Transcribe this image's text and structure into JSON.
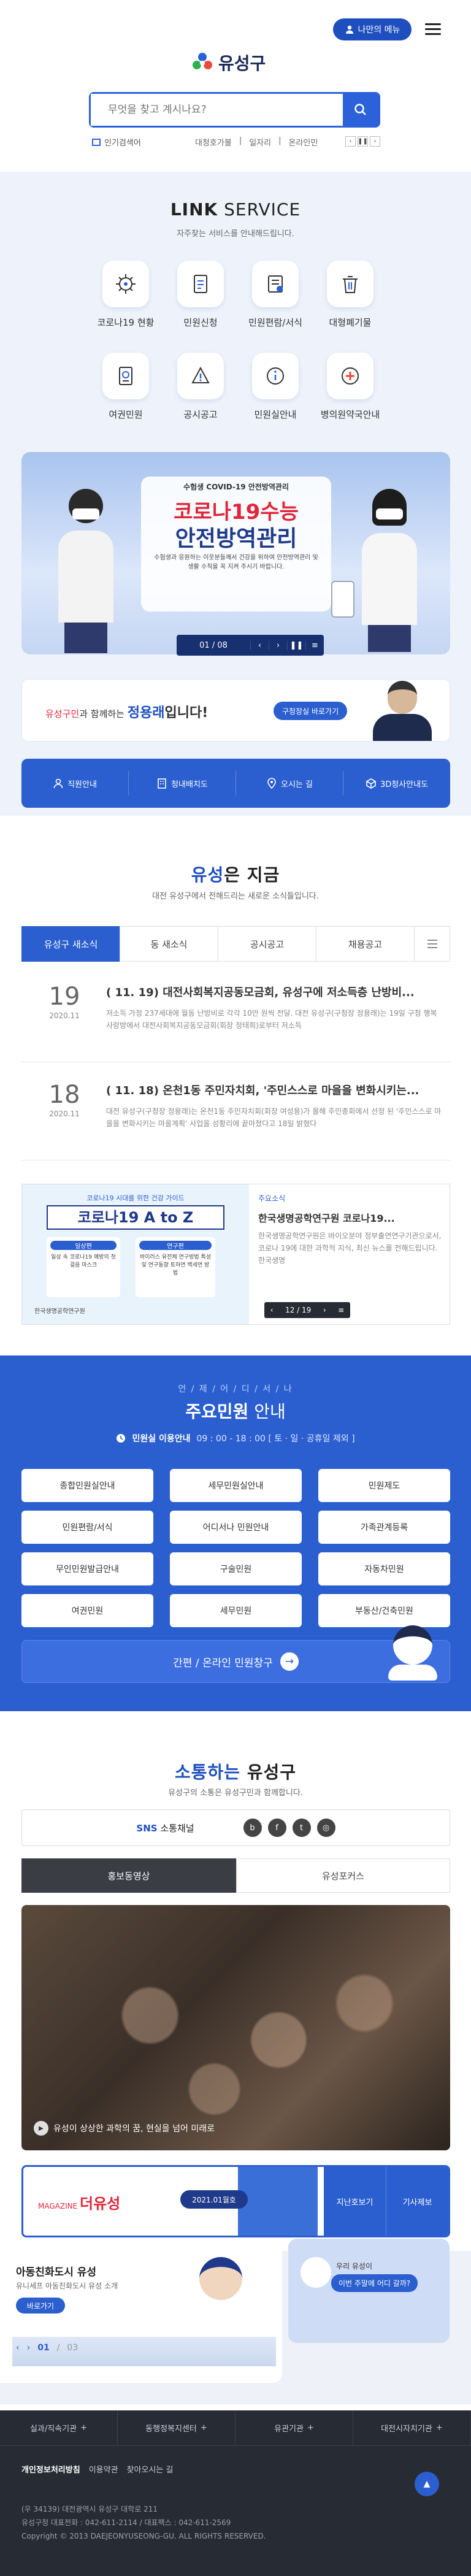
{
  "header": {
    "my_menu": "나만의 메뉴",
    "logo_text": "유성구",
    "search_placeholder": "무엇을 찾고 계시나요?",
    "popular_label": "인기검색어",
    "popular_tags": [
      "대청호가볼",
      "일자리",
      "온라인민"
    ],
    "page_prev": "‹",
    "page_next": "›"
  },
  "link": {
    "title_bold": "LINK",
    "title_rest": " SERVICE",
    "subtitle": "자주찾는 서비스를 안내해드립니다.",
    "items": [
      {
        "label": "코로나19 현황",
        "icon": "virus-icon"
      },
      {
        "label": "민원신청",
        "icon": "document-icon"
      },
      {
        "label": "민원편람/서식",
        "icon": "form-icon"
      },
      {
        "label": "대형폐기물",
        "icon": "trash-icon"
      },
      {
        "label": "여권민원",
        "icon": "passport-icon"
      },
      {
        "label": "공시공고",
        "icon": "notice-icon"
      },
      {
        "label": "민원실안내",
        "icon": "info-icon"
      },
      {
        "label": "병의원약국안내",
        "icon": "hospital-icon"
      }
    ]
  },
  "banner": {
    "top_text": "수험생 COVID-19 안전방역관리",
    "headline1": "코로나19수능",
    "headline2": "안전방역관리",
    "desc": "수험생과 응원하는 이웃분들께서 건강을 위하여 안전방역관리 및 생활 수칙을 꼭 지켜 주시기 바랍니다.",
    "counter": "01 / 08"
  },
  "mayor": {
    "prefix": "유성구민",
    "mid": "과 함께하는 ",
    "name": "정용래",
    "suffix": "입니다!",
    "button": "구청장실 바로가기"
  },
  "quick": [
    {
      "label": "직원안내",
      "icon": "person-icon"
    },
    {
      "label": "청내배치도",
      "icon": "building-icon"
    },
    {
      "label": "오시는 길",
      "icon": "map-icon"
    },
    {
      "label": "3D청사안내도",
      "icon": "3d-icon"
    }
  ],
  "now": {
    "title_blue": "유성",
    "title_rest": "은 지금",
    "subtitle": "대전 유성구에서 전해드리는 새로운 소식들입니다.",
    "tabs": [
      "유성구 새소식",
      "동 새소식",
      "공시공고",
      "채용공고"
    ],
    "news": [
      {
        "day": "19",
        "ym": "2020.11",
        "title": "( 11. 19) 대전사회복지공동모금회, 유성구에 저소득층 난방비...",
        "desc": "저소득 가정 237세대에 월동 난방비로 각각 10만 원씩 전달. 대전 유성구(구청장 정용래)는 19일 구청 행복사랑방에서 대전사회복지공동모금회(회장 정태희)로부터 저소득"
      },
      {
        "day": "18",
        "ym": "2020.11",
        "title": "( 11. 18) 온천1동 주민자치회, '주민스스로 마을을 변화시키는...",
        "desc": "대전 유성구(구청장 정용래)는 온천1동 주민자치회(회장 여성용)가 올해 주민총회에서 선정 된 '주민스스로 마을을 변화시키는 마을계획' 사업을 성황리에 끝마쳤다고 18일 밝혔다"
      }
    ],
    "mag": {
      "poster_small": "코로나19 시대를 위한 건강 가이드",
      "poster_title": "코로나19 A to Z",
      "poster_left": "일상편",
      "poster_left_desc": "일상 속 코로나19 예방의 첫 걸음 마스크",
      "poster_right": "연구편",
      "poster_right_desc": "바이러스 유전체 연구방법 특성 및 연구동향 토하연 백세연 방법",
      "org": "한국생명공학연구원",
      "badge": "주요소식",
      "title": "한국생명공학연구원 코로나19...",
      "desc": "한국생명공학연구원은 바이오분야 정부출연연구기관으로서, 코로나 19에 대한 과학적 지식, 최신 뉴스를 전해드립니다. 한국생명",
      "counter": "12 / 19"
    }
  },
  "civil": {
    "subtitle_small": "언 / 제 / 어 / 디 / 서 / 나",
    "title_bold": "주요민원",
    "title_rest": " 안내",
    "hours_label": "민원실 이용안내",
    "hours": "09 : 00 - 18 : 00 [ 토 · 일 · 공휴일 제외 ]",
    "buttons": [
      "종합민원실안내",
      "세무민원실안내",
      "민원제도",
      "민원편람/서식",
      "어디서나 민원안내",
      "가족관계등록",
      "무인민원발급안내",
      "구술민원",
      "자동차민원",
      "여권민원",
      "세무민원",
      "부동산/건축민원"
    ],
    "easy": "간편 / 온라인 민원창구"
  },
  "sotong": {
    "title_blue": "소통하는",
    "title_rest": " 유성구",
    "subtitle": "유성구의 소통은 유성구민과 함께합니다.",
    "sns_label": "SNS",
    "sns_rest": " 소통채널",
    "sns": [
      "blog-icon",
      "facebook-icon",
      "twitter-icon",
      "instagram-icon"
    ],
    "tab_on": "홍보동영상",
    "tab_off": "유성포커스",
    "video_caption": "유성이 상상한 과학의 꿈, 현실을 넘어 미래로"
  },
  "magazine": {
    "label": "MAGAZINE",
    "title": "더유성",
    "issue": "2021.01월호",
    "back": "지난호보기",
    "apply": "기사제보"
  },
  "family": {
    "title": "아동친화도시 유성",
    "desc": "유니세프 아동친화도시 유성 소개",
    "button": "바로가기",
    "counter_cur": "01",
    "counter_tot": "03"
  },
  "chat": {
    "greeting": "우리 유성이",
    "question": "이번 주말에 어디 갈까?"
  },
  "footer": {
    "nav": [
      "실과/직속기관",
      "동행정복지센터",
      "유관기관",
      "대전시자치기관"
    ],
    "privacy": "개인정보처리방침",
    "links": [
      "이용약관",
      "찾아오시는 길"
    ],
    "address": "(우 34139) 대전광역시 유성구 대학로 211",
    "tel": "유성구청 대표전화 : 042-611-2114 / 대표팩스 : 042-611-2569",
    "copy": "Copyright © 2013 DAEJEONYUSEONG-GU. ALL RIGHTS RESERVED."
  },
  "colors": {
    "primary": "#2b5fcf",
    "dark": "#17306f",
    "footer": "#272b33"
  }
}
